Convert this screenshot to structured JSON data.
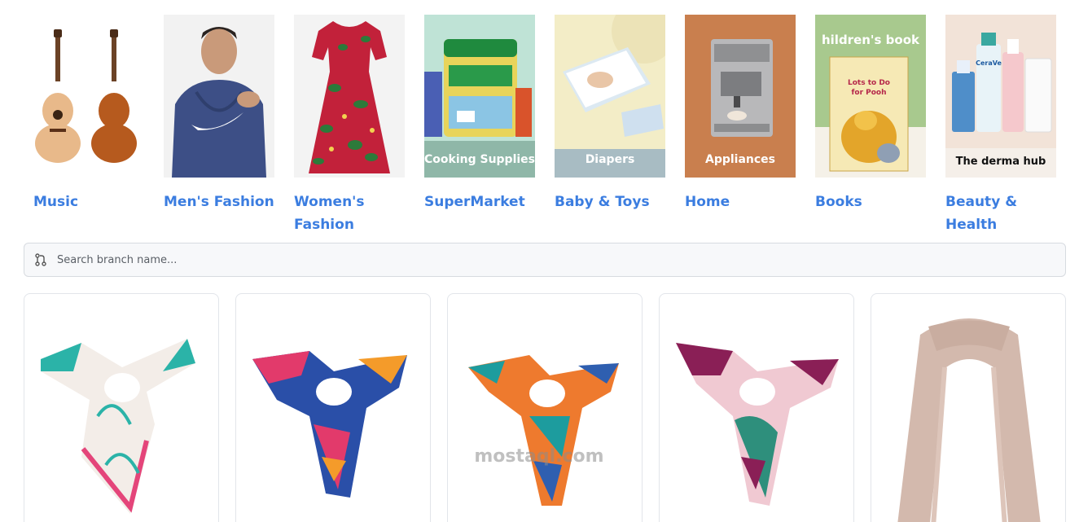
{
  "categories": [
    {
      "label": "Music",
      "overlay": ""
    },
    {
      "label": "Men's Fashion",
      "overlay": ""
    },
    {
      "label": "Women's Fashion",
      "overlay": ""
    },
    {
      "label": "SuperMarket",
      "overlay": "Cooking Supplies"
    },
    {
      "label": "Baby & Toys",
      "overlay": "Diapers"
    },
    {
      "label": "Home",
      "overlay": "Appliances"
    },
    {
      "label": "Books",
      "overlay": "hildren's book"
    },
    {
      "label": "Beauty & Health",
      "overlay": "The derma hub"
    }
  ],
  "search": {
    "placeholder": "Search branch name..."
  },
  "products": [
    {
      "name": "scarf-white-floral",
      "colors": [
        "#f3ede8",
        "#2bb3a8",
        "#e4457a"
      ]
    },
    {
      "name": "scarf-blue-red",
      "colors": [
        "#2a4fa8",
        "#e23a6b",
        "#f49b2a"
      ]
    },
    {
      "name": "scarf-orange-teal",
      "colors": [
        "#ee7a2e",
        "#1d9c9e",
        "#2f5fb0"
      ]
    },
    {
      "name": "scarf-purple-pink",
      "colors": [
        "#8a1f56",
        "#f0c9d2",
        "#2e8f7c"
      ]
    },
    {
      "name": "scarf-beige-plain",
      "colors": [
        "#d3b9ad",
        "#c9ada0",
        "#ddc5ba"
      ]
    }
  ],
  "watermark": {
    "text": "mostaql.com"
  },
  "book_title": "Lots to Do for Pooh",
  "cream_brand": "CeraVe"
}
